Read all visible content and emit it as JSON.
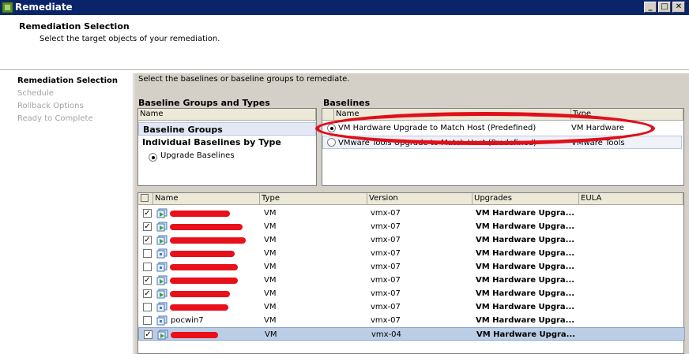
{
  "window": {
    "title": "Remediate",
    "minimize": "_",
    "maximize": "□",
    "close": "✕"
  },
  "header": {
    "title": "Remediation Selection",
    "subtitle": "Select the target objects of your remediation."
  },
  "steps": [
    {
      "label": "Remediation Selection",
      "active": true
    },
    {
      "label": "Schedule",
      "active": false
    },
    {
      "label": "Rollback Options",
      "active": false
    },
    {
      "label": "Ready to Complete",
      "active": false
    }
  ],
  "instruction": "Select the baselines or baseline groups to remediate.",
  "baseline_groups": {
    "title": "Baseline Groups and Types",
    "column_name": "Name",
    "groups_label": "Baseline Groups",
    "individual_label": "Individual Baselines by Type",
    "upgrade_label": "Upgrade Baselines"
  },
  "baselines": {
    "title": "Baselines",
    "columns": [
      "Name",
      "Type"
    ],
    "rows": [
      {
        "name": "VM Hardware Upgrade to Match Host (Predefined)",
        "type": "VM Hardware",
        "selected": true
      },
      {
        "name": "VMware Tools Upgrade to Match Host (Predefined)",
        "type": "VMware Tools",
        "selected": false
      }
    ]
  },
  "vm_table": {
    "columns": [
      "Name",
      "Type",
      "Version",
      "Upgrades",
      "EULA"
    ],
    "rows": [
      {
        "checked": true,
        "name": "",
        "type": "VM",
        "version": "vmx-07",
        "upgrades": "VM Hardware Upgra..."
      },
      {
        "checked": true,
        "name": "",
        "type": "VM",
        "version": "vmx-07",
        "upgrades": "VM Hardware Upgra..."
      },
      {
        "checked": true,
        "name": "",
        "type": "VM",
        "version": "vmx-07",
        "upgrades": "VM Hardware Upgra..."
      },
      {
        "checked": false,
        "name": "",
        "type": "VM",
        "version": "vmx-07",
        "upgrades": "VM Hardware Upgra..."
      },
      {
        "checked": false,
        "name": "",
        "type": "VM",
        "version": "vmx-07",
        "upgrades": "VM Hardware Upgra..."
      },
      {
        "checked": true,
        "name": "",
        "type": "VM",
        "version": "vmx-07",
        "upgrades": "VM Hardware Upgra..."
      },
      {
        "checked": true,
        "name": "",
        "type": "VM",
        "version": "vmx-07",
        "upgrades": "VM Hardware Upgra..."
      },
      {
        "checked": false,
        "name": "",
        "type": "VM",
        "version": "vmx-07",
        "upgrades": "VM Hardware Upgra..."
      },
      {
        "checked": false,
        "name": "pocwin7",
        "type": "VM",
        "version": "vmx-07",
        "upgrades": "VM Hardware Upgra..."
      },
      {
        "checked": true,
        "name": "",
        "type": "VM",
        "version": "vmx-04",
        "upgrades": "VM Hardware Upgra...",
        "selected": true
      }
    ]
  },
  "colors": {
    "title_bar": "#0a246a",
    "annotation": "#e0101a",
    "selected_row": "#bccde6"
  }
}
